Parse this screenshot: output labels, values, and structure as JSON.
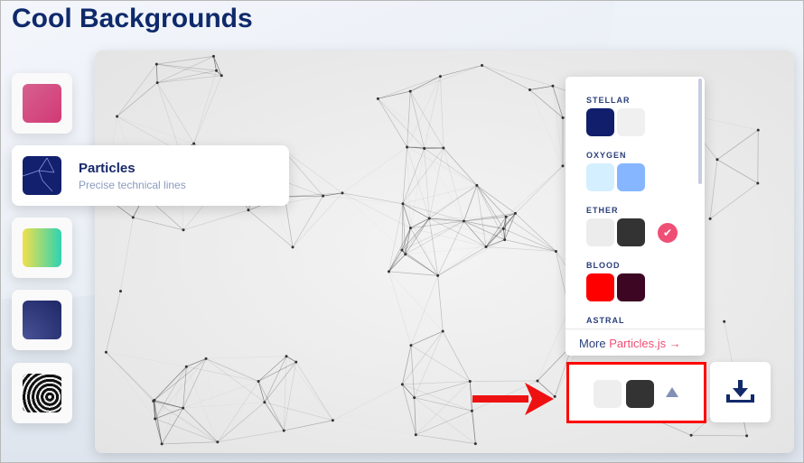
{
  "header": {
    "title": "Cool Backgrounds"
  },
  "sidebar": {
    "items": [
      {
        "id": "gradient-pink",
        "color": "#d6487f"
      },
      {
        "id": "particles",
        "label": "Particles",
        "description": "Precise technical lines",
        "color": "#12206e",
        "active": true
      },
      {
        "id": "gradient-yellow-teal",
        "color": "#2dd3b3"
      },
      {
        "id": "waves-navy",
        "color": "#27306e"
      },
      {
        "id": "dark-swirl",
        "color": "#222222"
      }
    ]
  },
  "theme_panel": {
    "themes": [
      {
        "name": "STELLAR",
        "colors": [
          "#111e6c",
          "#f0f0f0"
        ],
        "selected": false
      },
      {
        "name": "OXYGEN",
        "colors": [
          "#d4efff",
          "#86b6ff"
        ],
        "selected": false
      },
      {
        "name": "ETHER",
        "colors": [
          "#ececec",
          "#333333"
        ],
        "selected": true
      },
      {
        "name": "BLOOD",
        "colors": [
          "#ff0000",
          "#3d0623"
        ],
        "selected": false
      },
      {
        "name": "ASTRAL",
        "colors": [],
        "selected": false
      }
    ],
    "more_prefix": "More",
    "more_link": "Particles.js →"
  },
  "picker": {
    "colors": [
      "#ececec",
      "#333333"
    ],
    "toggle_icon": "triangle-up-icon"
  },
  "download": {
    "icon": "download-icon"
  },
  "annotation": {
    "arrow_color": "#ee1111",
    "highlight_color": "#ff0000"
  }
}
